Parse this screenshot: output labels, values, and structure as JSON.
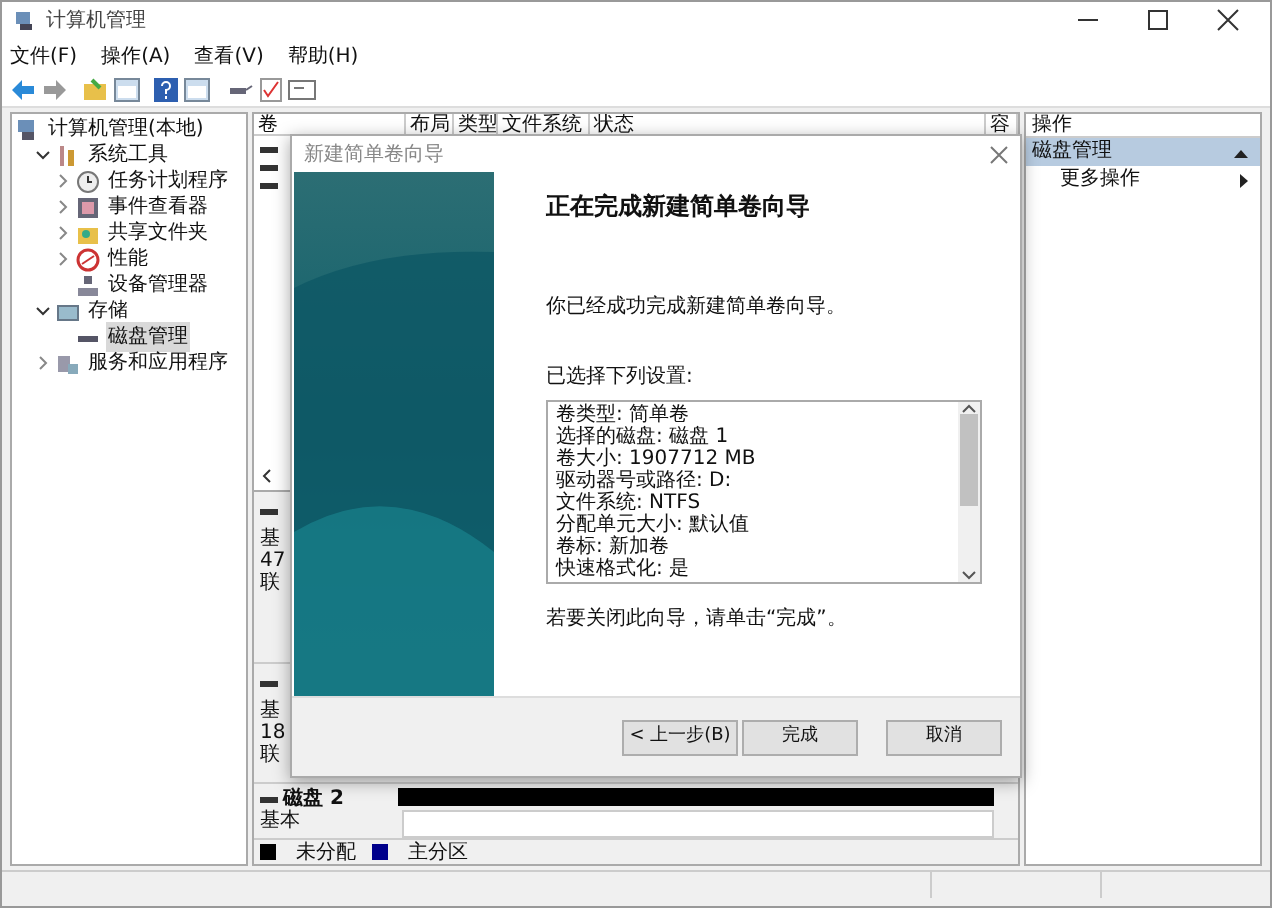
{
  "window": {
    "title": "计算机管理"
  },
  "menu": [
    "文件(F)",
    "操作(A)",
    "查看(V)",
    "帮助(H)"
  ],
  "tree": [
    {
      "label": "计算机管理(本地)",
      "selected": false,
      "children": [
        {
          "label": "系统工具",
          "expanded": true,
          "selected": false,
          "children": [
            {
              "label": "任务计划程序",
              "expanded": false,
              "selected": false
            },
            {
              "label": "事件查看器",
              "expanded": false,
              "selected": false
            },
            {
              "label": "共享文件夹",
              "expanded": false,
              "selected": false
            },
            {
              "label": "性能",
              "expanded": false,
              "selected": false
            },
            {
              "label": "设备管理器",
              "selected": false
            }
          ]
        },
        {
          "label": "存储",
          "expanded": true,
          "selected": false,
          "children": [
            {
              "label": "磁盘管理",
              "selected": true
            }
          ]
        },
        {
          "label": "服务和应用程序",
          "expanded": false,
          "selected": false
        }
      ]
    }
  ],
  "volume_table": {
    "columns": [
      "卷",
      "布局",
      "类型",
      "文件系统",
      "状态",
      "容"
    ]
  },
  "disks": [
    {
      "lines": [
        "基",
        "47",
        "联"
      ]
    },
    {
      "lines": [
        "基",
        "18",
        "联"
      ]
    },
    {
      "name": "磁盘 2",
      "lines": [
        "基本"
      ]
    }
  ],
  "legend": [
    {
      "label": "未分配",
      "color": "#000000"
    },
    {
      "label": "主分区",
      "color": "#00008b"
    }
  ],
  "actions": {
    "header": "操作",
    "items": [
      {
        "label": "磁盘管理",
        "kind": "section",
        "selected": true
      },
      {
        "label": "更多操作",
        "kind": "item",
        "selected": false
      }
    ]
  },
  "dialog": {
    "title": "新建简单卷向导",
    "heading": "正在完成新建简单卷向导",
    "intro": "你已经成功完成新建简单卷向导。",
    "settings_label": "已选择下列设置:",
    "settings": [
      "卷类型: 简单卷",
      "选择的磁盘: 磁盘 1",
      "卷大小: 1907712 MB",
      "驱动器号或路径: D:",
      "文件系统: NTFS",
      "分配单元大小: 默认值",
      "卷标: 新加卷",
      "快速格式化: 是"
    ],
    "closing": "若要关闭此向导，请单击“完成”。",
    "buttons": [
      "< 上一步(B)",
      "完成",
      "取消"
    ]
  }
}
